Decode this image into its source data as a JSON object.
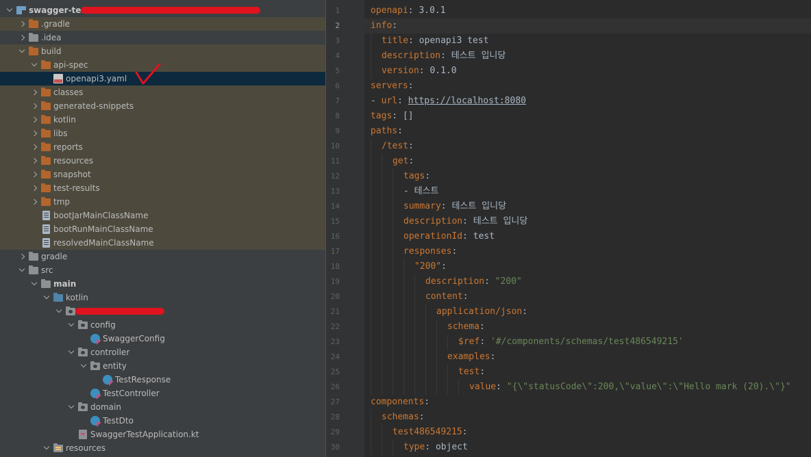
{
  "project_tree": {
    "items": [
      {
        "label": "swagger-test",
        "arrow": "down",
        "icon": "module-icon",
        "depth": 0,
        "bold": true,
        "excluded": false
      },
      {
        "label": ".gradle",
        "arrow": "right",
        "icon": "folder-orange-icon",
        "depth": 1,
        "excluded": true
      },
      {
        "label": ".idea",
        "arrow": "right",
        "icon": "folder-grey-icon",
        "depth": 1,
        "excluded": false
      },
      {
        "label": "build",
        "arrow": "down",
        "icon": "folder-orange-icon",
        "depth": 1,
        "excluded": true
      },
      {
        "label": "api-spec",
        "arrow": "down",
        "icon": "folder-orange-icon",
        "depth": 2,
        "excluded": true
      },
      {
        "label": "openapi3.yaml",
        "arrow": "none",
        "icon": "yaml-file-icon",
        "depth": 3,
        "selected": true
      },
      {
        "label": "classes",
        "arrow": "right",
        "icon": "folder-orange-icon",
        "depth": 2,
        "excluded": true
      },
      {
        "label": "generated-snippets",
        "arrow": "right",
        "icon": "folder-orange-icon",
        "depth": 2,
        "excluded": true
      },
      {
        "label": "kotlin",
        "arrow": "right",
        "icon": "folder-orange-icon",
        "depth": 2,
        "excluded": true
      },
      {
        "label": "libs",
        "arrow": "right",
        "icon": "folder-orange-icon",
        "depth": 2,
        "excluded": true
      },
      {
        "label": "reports",
        "arrow": "right",
        "icon": "folder-orange-icon",
        "depth": 2,
        "excluded": true
      },
      {
        "label": "resources",
        "arrow": "right",
        "icon": "folder-orange-icon",
        "depth": 2,
        "excluded": true
      },
      {
        "label": "snapshot",
        "arrow": "right",
        "icon": "folder-orange-icon",
        "depth": 2,
        "excluded": true
      },
      {
        "label": "test-results",
        "arrow": "right",
        "icon": "folder-orange-icon",
        "depth": 2,
        "excluded": true
      },
      {
        "label": "tmp",
        "arrow": "right",
        "icon": "folder-orange-icon",
        "depth": 2,
        "excluded": true
      },
      {
        "label": "bootJarMainClassName",
        "arrow": "none",
        "icon": "text-file-icon",
        "depth": 2,
        "excluded": true
      },
      {
        "label": "bootRunMainClassName",
        "arrow": "none",
        "icon": "text-file-icon",
        "depth": 2,
        "excluded": true
      },
      {
        "label": "resolvedMainClassName",
        "arrow": "none",
        "icon": "text-file-icon",
        "depth": 2,
        "excluded": true
      },
      {
        "label": "gradle",
        "arrow": "right",
        "icon": "folder-grey-icon",
        "depth": 1,
        "excluded": false
      },
      {
        "label": "src",
        "arrow": "down",
        "icon": "folder-grey-icon",
        "depth": 1,
        "excluded": false
      },
      {
        "label": "main",
        "arrow": "down",
        "icon": "folder-grey-icon",
        "depth": 2,
        "bold": true,
        "excluded": false
      },
      {
        "label": "kotlin",
        "arrow": "down",
        "icon": "folder-blue-icon",
        "depth": 3,
        "excluded": false
      },
      {
        "label": "",
        "arrow": "down",
        "icon": "package-icon",
        "depth": 4,
        "excluded": false
      },
      {
        "label": "config",
        "arrow": "down",
        "icon": "package-icon",
        "depth": 5,
        "excluded": false
      },
      {
        "label": "SwaggerConfig",
        "arrow": "none",
        "icon": "kotlin-class-icon",
        "depth": 6,
        "excluded": false
      },
      {
        "label": "controller",
        "arrow": "down",
        "icon": "package-icon",
        "depth": 5,
        "excluded": false
      },
      {
        "label": "entity",
        "arrow": "down",
        "icon": "package-icon",
        "depth": 6,
        "excluded": false
      },
      {
        "label": "TestResponse",
        "arrow": "none",
        "icon": "kotlin-class-icon",
        "depth": 7,
        "excluded": false
      },
      {
        "label": "TestController",
        "arrow": "none",
        "icon": "kotlin-class-icon",
        "depth": 6,
        "excluded": false
      },
      {
        "label": "domain",
        "arrow": "down",
        "icon": "package-icon",
        "depth": 5,
        "excluded": false
      },
      {
        "label": "TestDto",
        "arrow": "none",
        "icon": "kotlin-class-icon",
        "depth": 6,
        "excluded": false
      },
      {
        "label": "SwaggerTestApplication.kt",
        "arrow": "none",
        "icon": "kotlin-file-icon",
        "depth": 5,
        "excluded": false
      },
      {
        "label": "resources",
        "arrow": "down",
        "icon": "resources-folder-icon",
        "depth": 3,
        "excluded": false
      }
    ]
  },
  "editor": {
    "current_line": 2,
    "lines": [
      {
        "n": "1",
        "indent": 0,
        "parts": [
          [
            "k",
            "openapi"
          ],
          [
            "v",
            ": 3.0.1"
          ]
        ]
      },
      {
        "n": "2",
        "indent": 0,
        "parts": [
          [
            "k",
            "info"
          ],
          [
            "v",
            ":"
          ]
        ]
      },
      {
        "n": "3",
        "indent": 1,
        "parts": [
          [
            "k",
            "title"
          ],
          [
            "v",
            ": openapi3 test"
          ]
        ]
      },
      {
        "n": "4",
        "indent": 1,
        "parts": [
          [
            "k",
            "description"
          ],
          [
            "v",
            ": 테스트 입니당"
          ]
        ]
      },
      {
        "n": "5",
        "indent": 1,
        "parts": [
          [
            "k",
            "version"
          ],
          [
            "v",
            ": 0.1.0"
          ]
        ]
      },
      {
        "n": "6",
        "indent": 0,
        "parts": [
          [
            "k",
            "servers"
          ],
          [
            "v",
            ":"
          ]
        ]
      },
      {
        "n": "7",
        "indent": 0,
        "parts": [
          [
            "v",
            "- "
          ],
          [
            "k",
            "url"
          ],
          [
            "v",
            ": "
          ],
          [
            "u",
            "https://localhost:8080"
          ]
        ]
      },
      {
        "n": "8",
        "indent": 0,
        "parts": [
          [
            "k",
            "tags"
          ],
          [
            "v",
            ": []"
          ]
        ]
      },
      {
        "n": "9",
        "indent": 0,
        "parts": [
          [
            "k",
            "paths"
          ],
          [
            "v",
            ":"
          ]
        ]
      },
      {
        "n": "10",
        "indent": 1,
        "parts": [
          [
            "k",
            "/test"
          ],
          [
            "v",
            ":"
          ]
        ]
      },
      {
        "n": "11",
        "indent": 2,
        "parts": [
          [
            "k",
            "get"
          ],
          [
            "v",
            ":"
          ]
        ]
      },
      {
        "n": "12",
        "indent": 3,
        "parts": [
          [
            "k",
            "tags"
          ],
          [
            "v",
            ":"
          ]
        ]
      },
      {
        "n": "13",
        "indent": 3,
        "parts": [
          [
            "v",
            "- 테스트"
          ]
        ]
      },
      {
        "n": "14",
        "indent": 3,
        "parts": [
          [
            "k",
            "summary"
          ],
          [
            "v",
            ": 테스트 입니당"
          ]
        ]
      },
      {
        "n": "15",
        "indent": 3,
        "parts": [
          [
            "k",
            "description"
          ],
          [
            "v",
            ": 테스트 입니당"
          ]
        ]
      },
      {
        "n": "16",
        "indent": 3,
        "parts": [
          [
            "k",
            "operationId"
          ],
          [
            "v",
            ": test"
          ]
        ]
      },
      {
        "n": "17",
        "indent": 3,
        "parts": [
          [
            "k",
            "responses"
          ],
          [
            "v",
            ":"
          ]
        ]
      },
      {
        "n": "18",
        "indent": 4,
        "parts": [
          [
            "k",
            "\"200\""
          ],
          [
            "v",
            ":"
          ]
        ]
      },
      {
        "n": "19",
        "indent": 5,
        "parts": [
          [
            "k",
            "description"
          ],
          [
            "v",
            ": "
          ],
          [
            "s",
            "\"200\""
          ]
        ]
      },
      {
        "n": "20",
        "indent": 5,
        "parts": [
          [
            "k",
            "content"
          ],
          [
            "v",
            ":"
          ]
        ]
      },
      {
        "n": "21",
        "indent": 6,
        "parts": [
          [
            "k",
            "application/json"
          ],
          [
            "v",
            ":"
          ]
        ]
      },
      {
        "n": "22",
        "indent": 7,
        "parts": [
          [
            "k",
            "schema"
          ],
          [
            "v",
            ":"
          ]
        ]
      },
      {
        "n": "23",
        "indent": 8,
        "parts": [
          [
            "k",
            "$ref"
          ],
          [
            "v",
            ": "
          ],
          [
            "s",
            "'#/components/schemas/test486549215'"
          ]
        ]
      },
      {
        "n": "24",
        "indent": 7,
        "parts": [
          [
            "k",
            "examples"
          ],
          [
            "v",
            ":"
          ]
        ]
      },
      {
        "n": "25",
        "indent": 8,
        "parts": [
          [
            "k",
            "test"
          ],
          [
            "v",
            ":"
          ]
        ]
      },
      {
        "n": "26",
        "indent": 9,
        "parts": [
          [
            "k",
            "value"
          ],
          [
            "v",
            ": "
          ],
          [
            "s",
            "\"{\\\"statusCode\\\":200,\\\"value\\\":\\\"Hello mark (20).\\\"}\""
          ]
        ]
      },
      {
        "n": "27",
        "indent": 0,
        "parts": [
          [
            "k",
            "components"
          ],
          [
            "v",
            ":"
          ]
        ]
      },
      {
        "n": "28",
        "indent": 1,
        "parts": [
          [
            "k",
            "schemas"
          ],
          [
            "v",
            ":"
          ]
        ]
      },
      {
        "n": "29",
        "indent": 2,
        "parts": [
          [
            "k",
            "test486549215"
          ],
          [
            "v",
            ":"
          ]
        ]
      },
      {
        "n": "30",
        "indent": 3,
        "parts": [
          [
            "k",
            "type"
          ],
          [
            "v",
            ": object"
          ]
        ]
      }
    ],
    "fold_markers": [
      2,
      5,
      6,
      7,
      9,
      10,
      11,
      12,
      17,
      18,
      20,
      21,
      22,
      23,
      24,
      25,
      26,
      27
    ]
  },
  "colors": {
    "keyword": "#cc7832",
    "string": "#6a8759",
    "text": "#a9b7c6",
    "excluded_bg": "#4d4a3d",
    "selected_bg": "#0d293e"
  }
}
